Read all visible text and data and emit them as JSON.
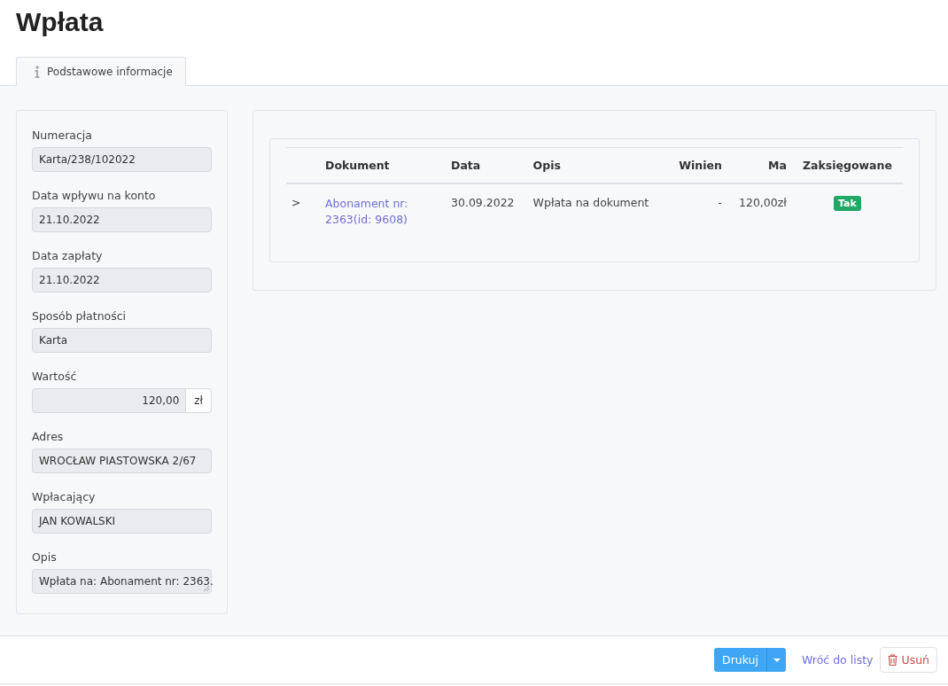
{
  "title": "Wpłata",
  "tabs": [
    {
      "label": "Podstawowe informacje",
      "selected": true
    }
  ],
  "fields": [
    {
      "kind": "text",
      "label": "Numeracja",
      "value": "Karta/238/102022"
    },
    {
      "kind": "text",
      "label": "Data wpływu na konto",
      "value": "21.10.2022"
    },
    {
      "kind": "text",
      "label": "Data zapłaty",
      "value": "21.10.2022"
    },
    {
      "kind": "text",
      "label": "Sposób płatności",
      "value": "Karta"
    },
    {
      "kind": "money",
      "label": "Wartość",
      "value": "120,00",
      "suffix": "zł"
    },
    {
      "kind": "text",
      "label": "Adres",
      "value": "WROCŁAW PIASTOWSKA 2/67"
    },
    {
      "kind": "text",
      "label": "Wpłacający",
      "value": "JAN KOWALSKI"
    },
    {
      "kind": "textarea",
      "label": "Opis",
      "value": "Wpłata na: Abonament nr: 2363."
    }
  ],
  "table": {
    "columns": [
      "Dokument",
      "Data",
      "Opis",
      "Winien",
      "Ma",
      "Zaksięgowane"
    ],
    "rows": [
      {
        "expander": ">",
        "document": "Abonament nr: 2363(id: 9608)",
        "date": "30.09.2022",
        "description": "Wpłata na dokument",
        "debit": "-",
        "credit": "120,00zł",
        "posted": "Tak"
      }
    ]
  },
  "footer": {
    "print_button": "Drukuj",
    "back_link": "Wróć do listy",
    "delete_button": "Usuń"
  }
}
